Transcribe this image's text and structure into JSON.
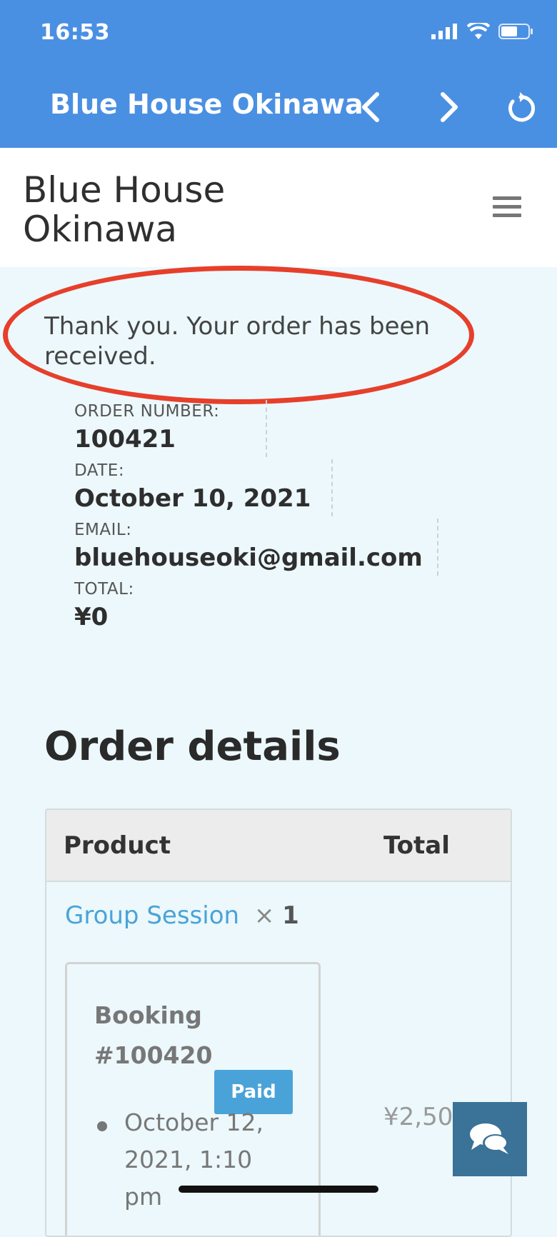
{
  "status_bar": {
    "time": "16:53"
  },
  "app_bar": {
    "title": "Blue House Okinawa",
    "icons": [
      "chevron-left-icon",
      "chevron-right-icon",
      "reload-icon"
    ]
  },
  "site": {
    "title": "Blue House Okinawa"
  },
  "notice": {
    "text": "Thank you. Your order has been received."
  },
  "order_overview": {
    "order_number_label": "ORDER NUMBER:",
    "order_number": "100421",
    "date_label": "DATE:",
    "date": "October 10, 2021",
    "email_label": "EMAIL:",
    "email": "bluehouseoki@gmail.com",
    "total_label": "TOTAL:",
    "total": "¥0"
  },
  "order_details": {
    "title": "Order details",
    "columns": {
      "product": "Product",
      "total": "Total"
    },
    "rows": [
      {
        "product": "Group Session",
        "quantity_prefix": "×",
        "quantity": "1",
        "booking_title": "Booking #100420",
        "booking_status": "Paid",
        "booking_date": "October 12, 2021, 1:10 pm",
        "total": "¥2,50"
      }
    ]
  },
  "colors": {
    "app_bar": "#4a90e2",
    "page_bg": "#ecf8fb",
    "accent": "#4aa3d8",
    "highlight": "#e63f2b",
    "chat_button": "#3a7298"
  }
}
